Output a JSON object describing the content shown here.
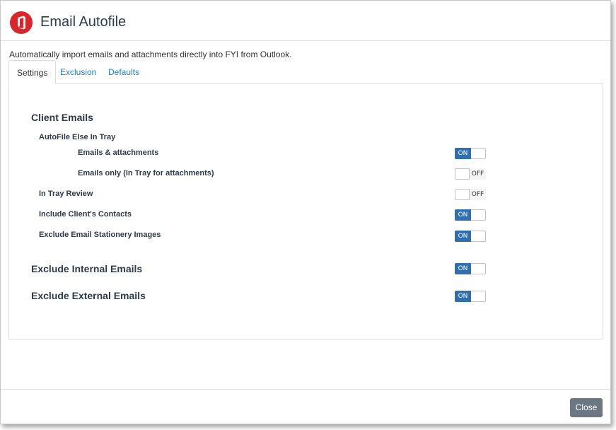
{
  "dialog": {
    "title": "Email Autofile",
    "description": "Automatically import emails and attachments directly into FYI from Outlook.",
    "logo_icon": "office-logo-icon",
    "brand_color": "#d9262b"
  },
  "tabs": [
    {
      "label": "Settings",
      "active": true
    },
    {
      "label": "Exclusion",
      "active": false
    },
    {
      "label": "Defaults",
      "active": false
    }
  ],
  "settings": {
    "client_emails": "Client Emails",
    "autofile_else_in_tray": "AutoFile Else In Tray",
    "rows": [
      {
        "label": "Emails & attachments",
        "state": "ON"
      },
      {
        "label": "Emails only (In Tray for attachments)",
        "state": "OFF"
      },
      {
        "label": "In Tray Review",
        "state": "OFF"
      },
      {
        "label": "Include Client's Contacts",
        "state": "ON"
      },
      {
        "label": "Exclude Email Stationery Images",
        "state": "ON"
      },
      {
        "label": "Exclude Internal Emails",
        "state": "ON"
      },
      {
        "label": "Exclude External Emails",
        "state": "ON"
      }
    ],
    "toggle_on_color": "#2f6fb0"
  },
  "footer": {
    "close_label": "Close"
  }
}
